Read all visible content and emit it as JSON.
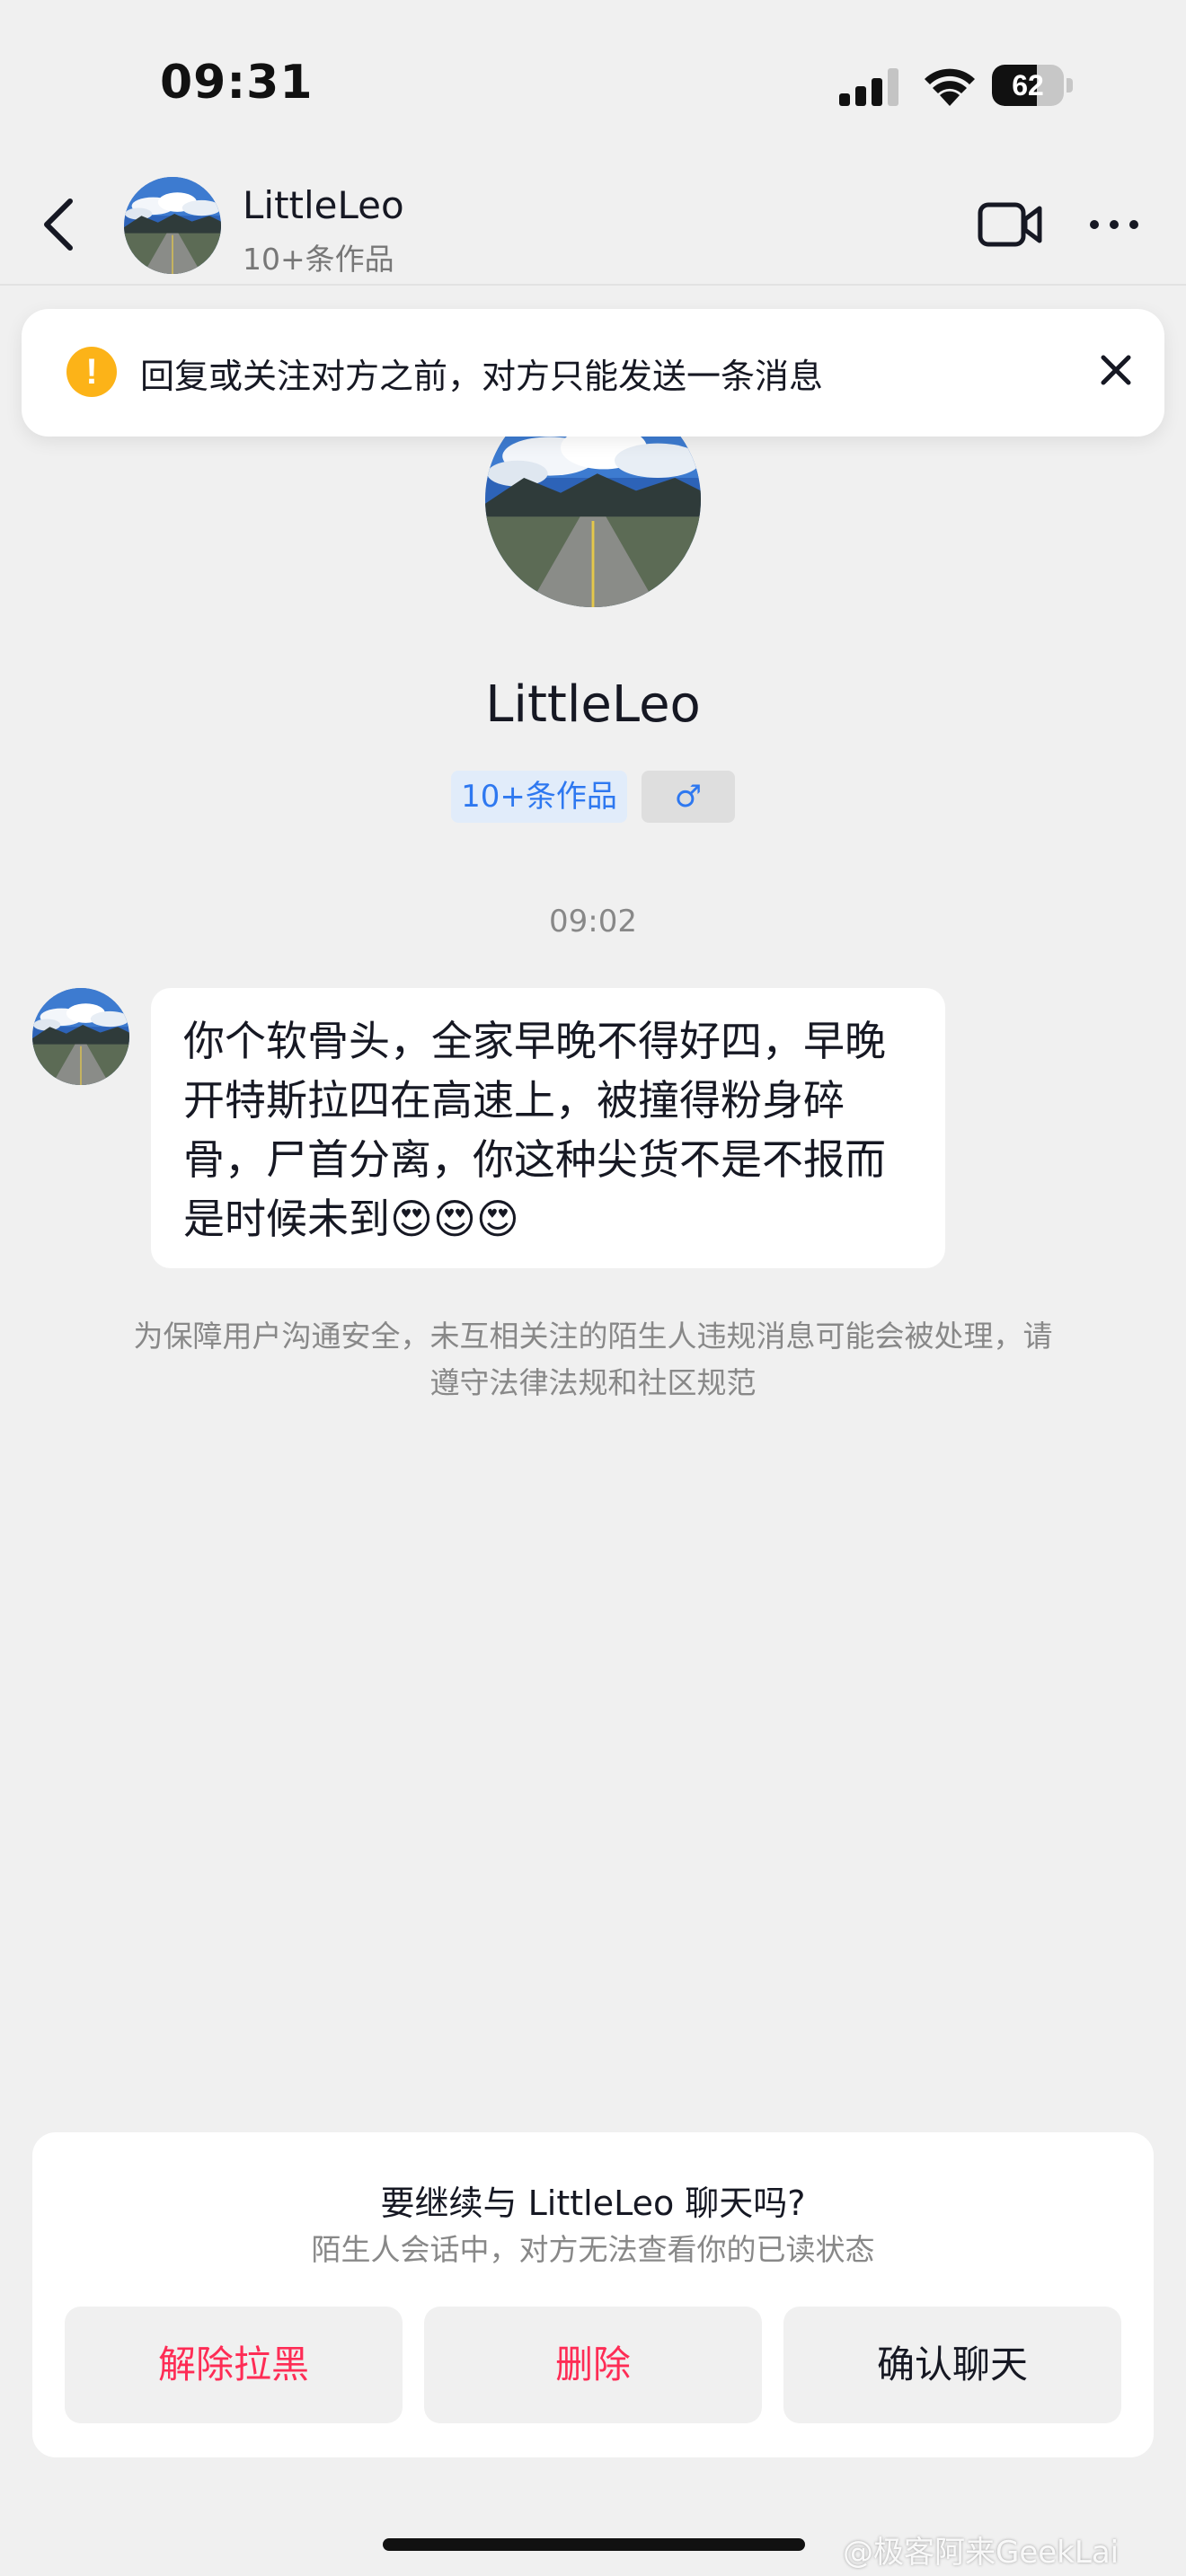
{
  "status_bar": {
    "time": "09:31",
    "battery_level": "62",
    "battery_fraction": 0.62
  },
  "nav": {
    "name": "LittleLeo",
    "subtitle": "10+条作品"
  },
  "banner": {
    "text": "回复或关注对方之前，对方只能发送一条消息",
    "icon": "exclamation-icon",
    "icon_color": "#fcb318"
  },
  "profile": {
    "name": "LittleLeo",
    "works_tag": "10+条作品",
    "gender_tag": "♂"
  },
  "conversation": {
    "timestamp": "09:02",
    "message": "你个软骨头，全家早晚不得好四，早晚开特斯拉四在高速上，被撞得粉身碎骨，尸首分离，你这种尖货不是不报而是时候未到😍😍😍",
    "safety_note": "为保障用户沟通安全，未互相关注的陌生人违规消息可能会被处理，请遵守法律法规和社区规范"
  },
  "prompt_card": {
    "title": "要继续与 LittleLeo 聊天吗?",
    "subtitle": "陌生人会话中，对方无法查看你的已读状态",
    "buttons": {
      "unblock": "解除拉黑",
      "delete": "删除",
      "confirm": "确认聊天"
    }
  },
  "watermark": "@极客阿来GeekLai",
  "colors": {
    "accent_red": "#fe2c55",
    "tag_blue": "#2e78f0",
    "background": "#f0f0f0"
  }
}
